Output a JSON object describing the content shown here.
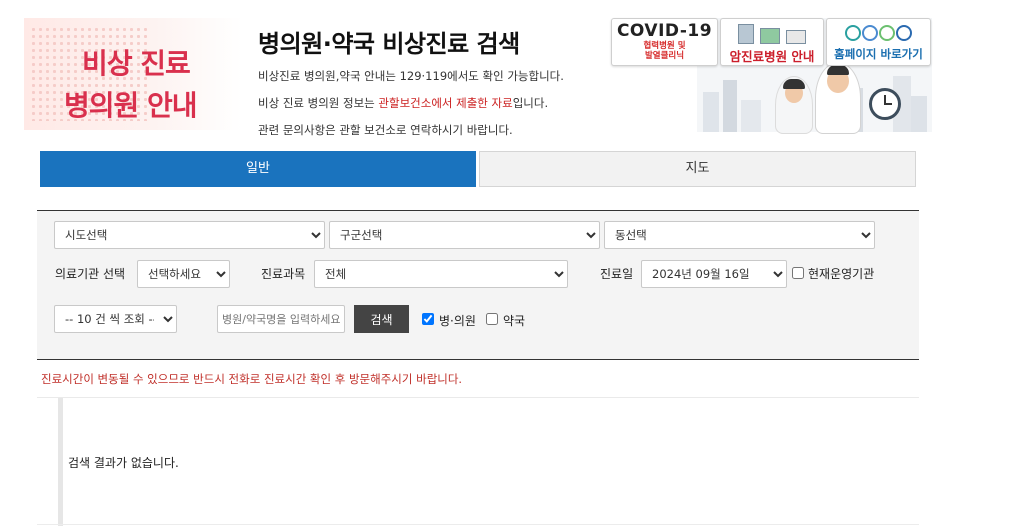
{
  "banner_left": {
    "line1": "비상 진료",
    "line2": "병의원 안내"
  },
  "info": {
    "title": "병의원·약국 비상진료 검색",
    "line1": "비상진료 병의원,약국 안내는 129·119에서도 확인 가능합니다.",
    "line2_prefix": "비상 진료 병의원 정보는 ",
    "line2_highlight": "관할보건소에서 제출한 자료",
    "line2_suffix": "입니다.",
    "line3": "관련 문의사항은 관할 보건소로 연락하시기 바랍니다."
  },
  "quick_links": {
    "covid_title": "COVID-19",
    "covid_sub1": "협력병원 및",
    "covid_sub2": "발열클리닉",
    "cancer_label": "암진료병원 안내",
    "home_label": "홈페이지 바로가기"
  },
  "tabs": {
    "general": "일반",
    "map": "지도"
  },
  "filters": {
    "sido": {
      "selected": "시도선택"
    },
    "gugun": {
      "selected": "구군선택"
    },
    "dong": {
      "selected": "동선택"
    },
    "org_type": {
      "label": "의료기관 선택",
      "selected": "선택하세요"
    },
    "department": {
      "label": "진료과목",
      "selected": "전체"
    },
    "date": {
      "label": "진료일",
      "selected": "2024년 09월 16일"
    },
    "currently_open": {
      "label": "현재운영기관",
      "checked": false
    },
    "page_size": {
      "selected": "-- 10 건 씩 조회 --"
    },
    "search_input": {
      "placeholder": "병원/약국명을 입력하세요",
      "value": ""
    },
    "search_button": "검색",
    "hospital": {
      "label": "병·의원",
      "checked": true
    },
    "pharmacy": {
      "label": "약국",
      "checked": false
    }
  },
  "notice": "진료시간이 변동될 수 있으므로 반드시 전화로 진료시간 확인 후 방문해주시기 바랍니다.",
  "results": {
    "empty_message": "검색 결과가 없습니다."
  }
}
